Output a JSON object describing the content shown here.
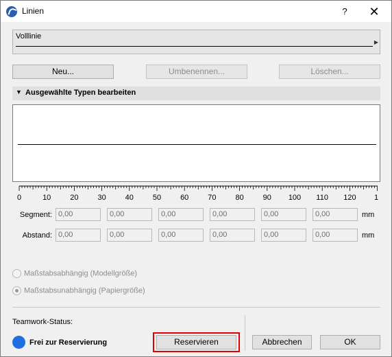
{
  "window": {
    "title": "Linien",
    "help": "?",
    "close": "✕"
  },
  "line_type": {
    "name": "Volllinie",
    "arrow": "▶"
  },
  "buttons": {
    "new": "Neu...",
    "rename": "Umbenennen...",
    "delete": "Löschen..."
  },
  "section": {
    "toggle": "▼",
    "title": "Ausgewählte Typen bearbeiten"
  },
  "ruler": {
    "labels": [
      "0",
      "10",
      "20",
      "30",
      "40",
      "50",
      "60",
      "70",
      "80",
      "90",
      "100",
      "110",
      "120",
      "1"
    ]
  },
  "segment": {
    "label": "Segment:",
    "values": [
      "0,00",
      "0,00",
      "0,00",
      "0,00",
      "0,00",
      "0,00"
    ],
    "unit": "mm"
  },
  "spacing": {
    "label": "Abstand:",
    "values": [
      "0,00",
      "0,00",
      "0,00",
      "0,00",
      "0,00",
      "0,00"
    ],
    "unit": "mm"
  },
  "scale": {
    "option1": "Maßstabsabhängig (Modellgröße)",
    "option2": "Maßstabsunabhängig (Papiergröße)",
    "selected": 2
  },
  "teamwork": {
    "label": "Teamwork-Status:",
    "status": "Frei zur Reservierung",
    "status_color": "#1f6fe0"
  },
  "footer": {
    "reserve": "Reservieren",
    "cancel": "Abbrechen",
    "ok": "OK"
  }
}
